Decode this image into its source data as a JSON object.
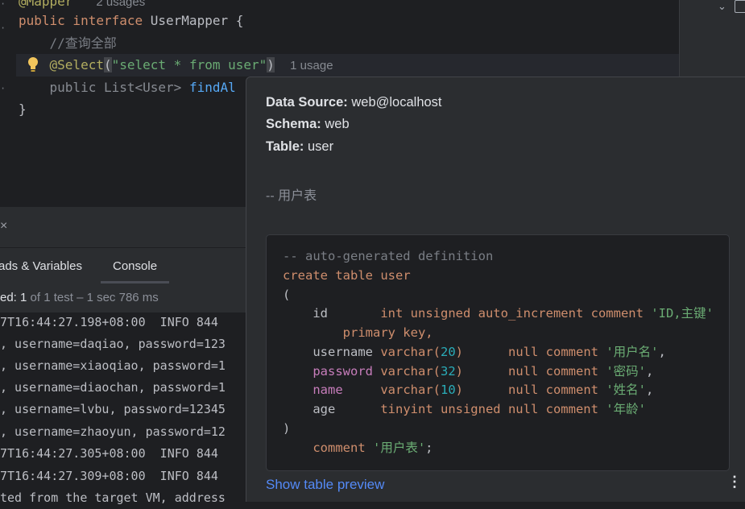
{
  "editor": {
    "lines": [
      {
        "annotation": "@Mapper",
        "usage": "2 usages"
      },
      {
        "kw": "public interface ",
        "name": "UserMapper {"
      },
      {
        "comment": "//查询全部"
      },
      {
        "ann": "@Select",
        "open": "(",
        "str": "\"select * from user\"",
        "close": ")",
        "usage": "1 usage"
      },
      {
        "kw": "public ",
        "type": "List<User> ",
        "fn": "findAl"
      },
      {
        "text": "}"
      }
    ]
  },
  "run_panel": {
    "close": "×",
    "tabs": [
      "ads & Variables",
      "Console"
    ],
    "status": {
      "prefix": "ed: ",
      "count": "1",
      "rest": " of 1 test – 1 sec 786 ms"
    },
    "log": [
      "7T16:44:27.198+08:00  INFO 844",
      ", username=daqiao, password=123",
      ", username=xiaoqiao, password=1",
      ", username=diaochan, password=1",
      ", username=lvbu, password=12345",
      ", username=zhaoyun, password=12",
      "7T16:44:27.305+08:00  INFO 844",
      "7T16:44:27.309+08:00  INFO 844",
      "ted from the target VM, address"
    ]
  },
  "popup": {
    "data_source_label": "Data Source:",
    "data_source": "web@localhost",
    "schema_label": "Schema:",
    "schema": "web",
    "table_label": "Table:",
    "table": "user",
    "table_comment": "-- 用户表",
    "code": {
      "l1": "-- auto-generated definition",
      "l2a": "create table ",
      "l2b": "user",
      "l3": "(",
      "l4": {
        "col": "id",
        "type": "int unsigned auto_increment comment ",
        "str": "'ID,主键'"
      },
      "l5": "primary key,",
      "l6": {
        "col": "username",
        "type": "varchar(",
        "num": "20",
        "end": ")",
        "rest": "null comment ",
        "str": "'用户名'",
        "comma": ","
      },
      "l7": {
        "col": "password",
        "type": "varchar(",
        "num": "32",
        "end": ")",
        "rest": "null comment ",
        "str": "'密码'",
        "comma": ","
      },
      "l8": {
        "col": "name",
        "type": "varchar(",
        "num": "10",
        "end": ")",
        "rest": "null comment ",
        "str": "'姓名'",
        "comma": ","
      },
      "l9": {
        "col": "age",
        "type": "tinyint unsigned null comment ",
        "str": "'年龄'"
      },
      "l10": ")",
      "l11": {
        "kw": "comment ",
        "str": "'用户表'",
        "end": ";"
      }
    },
    "preview_link": "Show table preview",
    "more": "⋮"
  }
}
